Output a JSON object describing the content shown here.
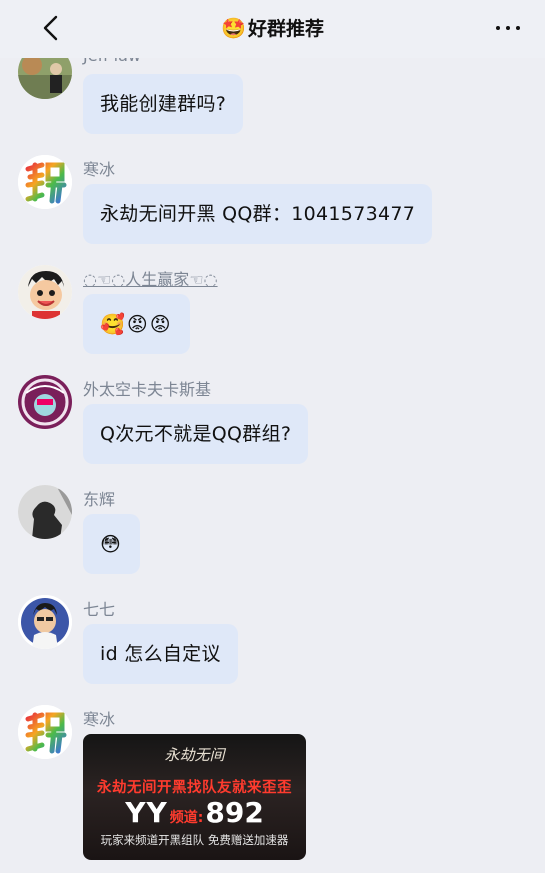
{
  "header": {
    "title_emoji": "🤩",
    "title": "好群推荐"
  },
  "messages": [
    {
      "name": "Jeff law",
      "text": "我能创建群吗?",
      "avatar": "avatar-photo-icon"
    },
    {
      "name": "寒冰",
      "text": "永劫无间开黑 QQ群：1041573477",
      "avatar": "xi-character-icon"
    },
    {
      "name": "◌☜◌人生赢家☜◌",
      "text": "🥰😡😡",
      "avatar": "cartoon-boy-icon"
    },
    {
      "name": "外太空卡夫卡斯基",
      "text": "Q次元不就是QQ群组?",
      "avatar": "badge-icon"
    },
    {
      "name": "东辉",
      "text": "😳",
      "avatar": "silhouette-icon"
    },
    {
      "name": "七七",
      "text": "id 怎么自定议",
      "avatar": "cartoon-man-icon"
    },
    {
      "name": "寒冰",
      "avatar": "xi-character-icon"
    }
  ],
  "banner": {
    "brand": "永劫无间",
    "headline": "永劫无间开黑找队友就来歪歪",
    "yy": "YY",
    "channel_label": "频道:",
    "channel_number": "892",
    "footer": "玩家来频道开黑组队 免费赠送加速器"
  }
}
